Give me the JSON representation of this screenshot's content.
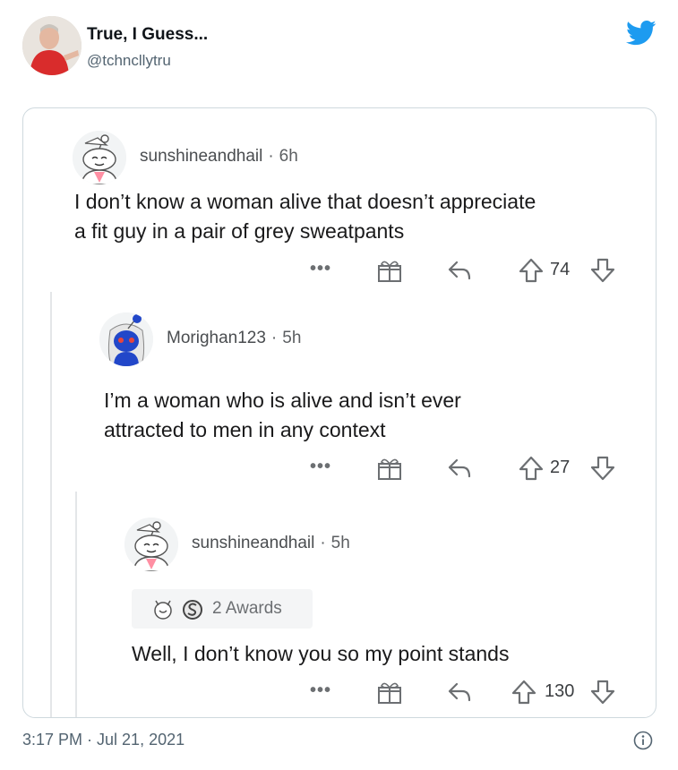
{
  "tweet": {
    "display_name": "True, I Guess...",
    "handle": "@tchncllytru",
    "timestamp": "3:17 PM · Jul 21, 2021"
  },
  "comments": [
    {
      "user": "sunshineandhail",
      "age": "6h",
      "lines": [
        "I don’t know a woman alive that doesn’t appreciate",
        "a fit guy in a pair of grey sweatpants"
      ],
      "score": "74"
    },
    {
      "user": "Morighan123",
      "age": "5h",
      "lines": [
        "I’m a woman who is alive and isn’t ever",
        "attracted to men in any context"
      ],
      "score": "27"
    },
    {
      "user": "sunshineandhail",
      "age": "5h",
      "awards": "2 Awards",
      "lines": [
        "Well, I don’t know you so my point stands"
      ],
      "score": "130"
    }
  ],
  "actions": {
    "more": "•••"
  },
  "icons": [
    "twitter-bird-icon",
    "gift-icon",
    "reply-icon",
    "upvote-icon",
    "downvote-icon",
    "info-icon"
  ],
  "colors": {
    "twitter_blue": "#1d9bf0",
    "snoo_blue": "#2247c9",
    "text_gray": "#536471"
  }
}
